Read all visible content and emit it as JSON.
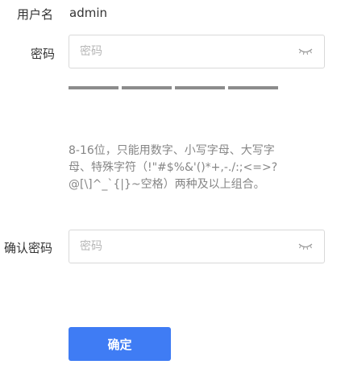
{
  "form": {
    "username": {
      "label": "用户名",
      "value": "admin"
    },
    "password": {
      "label": "密码",
      "placeholder": "密码",
      "toggle_icon": "eye-closed-icon"
    },
    "strength": {
      "segments": 4,
      "color": "#8c8c8c"
    },
    "hint_lines": [
      "8-16位，只能用数字、小写字母、大写字",
      "母、特殊字符（!\"#$%&'()*+,-./:;<=>?",
      "@[\\]^_`{|}~空格）两种及以上组合。"
    ],
    "confirm_password": {
      "label": "确认密码",
      "placeholder": "密码",
      "toggle_icon": "eye-closed-icon"
    },
    "submit": {
      "label": "确定",
      "color": "#3f7cf4"
    }
  }
}
